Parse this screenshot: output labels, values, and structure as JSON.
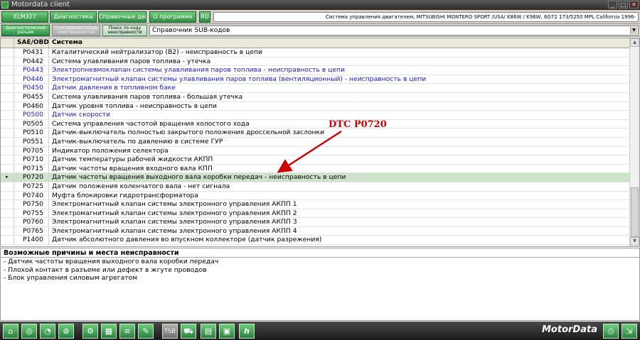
{
  "window": {
    "title": "Motordata client"
  },
  "menu": {
    "buttons": [
      "ELM327",
      "Диагностика",
      "Справочные данные",
      "О программе",
      "RU"
    ],
    "vehicle_info": "Система управления двигателем, MITSUBISHI  MONTERO SPORT /USA/  K86W / K96W,  6G72  173/5250  MPL California  1996-"
  },
  "toolbar2": {
    "btn1": "Диагностический разъём",
    "btn2": "Считывание кодов неисправностей",
    "btn3": "Поиск по коду неисправности",
    "select_value": "Справочник SUB-кодов"
  },
  "grid": {
    "headers": {
      "code": "SAE/OBD",
      "system": "Система"
    },
    "rows": [
      {
        "code": "P0431",
        "desc": "Каталитический нейтрализатор (B2) - неисправность в цепи",
        "link": false
      },
      {
        "code": "P0442",
        "desc": "Система улавливания паров топлива - утечка",
        "link": false
      },
      {
        "code": "P0443",
        "desc": "Электропневмоклапан системы улавливания паров топлива - неисправность в цепи",
        "link": true
      },
      {
        "code": "P0446",
        "desc": "Электромагнитный клапан системы улавливания паров топлива (вентиляционный) - неисправность в цепи",
        "link": true
      },
      {
        "code": "P0450",
        "desc": "Датчик давления в топливном баке",
        "link": true
      },
      {
        "code": "P0455",
        "desc": "Система улавливания паров топлива - большая утечка",
        "link": false
      },
      {
        "code": "P0460",
        "desc": "Датчик уровня топлива - неисправность в цепи",
        "link": false
      },
      {
        "code": "P0500",
        "desc": "Датчик скорости",
        "link": true
      },
      {
        "code": "P0505",
        "desc": "Система управления частотой вращения холостого хода",
        "link": false
      },
      {
        "code": "P0510",
        "desc": "Датчик-выключатель полностью закрытого положения дроссельной заслонки",
        "link": false
      },
      {
        "code": "P0551",
        "desc": "Датчик-выключатель по давлению в системе ГУР",
        "link": false
      },
      {
        "code": "P0705",
        "desc": "Индикатор положения селектора",
        "link": false
      },
      {
        "code": "P0710",
        "desc": "Датчик температуры рабочей жидкости АКПП",
        "link": false
      },
      {
        "code": "P0715",
        "desc": "Датчик частоты вращения входного вала КПП",
        "link": false
      },
      {
        "code": "P0720",
        "desc": "Датчик частоты вращения выходного вала коробки передач - неисправность в цепи",
        "link": false,
        "selected": true
      },
      {
        "code": "P0725",
        "desc": "Датчик положения коленчатого вала - нет сигнала",
        "link": false
      },
      {
        "code": "P0740",
        "desc": "Муфта блокировки гидротрансформатора",
        "link": false
      },
      {
        "code": "P0750",
        "desc": "Электромагнитный клапан системы электронного управления АКПП 1",
        "link": false
      },
      {
        "code": "P0755",
        "desc": "Электромагнитный клапан системы электронного управления АКПП 2",
        "link": false
      },
      {
        "code": "P0760",
        "desc": "Электромагнитный клапан системы электронного управления АКПП 3",
        "link": false
      },
      {
        "code": "P0765",
        "desc": "Электромагнитный клапан системы электронного управления АКПП 4",
        "link": false
      },
      {
        "code": "P1400",
        "desc": "Датчик абсолютного давления во впускном коллекторе (датчик разрежения)",
        "link": false
      }
    ]
  },
  "annotation": {
    "text": "DTC P0720",
    "color": "#cc0000"
  },
  "causes": {
    "title": "Возможные причины и места неисправности",
    "items": [
      "- Датчик частоты вращения выходного вала коробки передач",
      "- Плохой контакт в разъеме или дефект в жгуте проводов",
      "- Блок управления силовым агрегатом"
    ]
  },
  "bottombar": {
    "brand": "MotorData",
    "icons": [
      "home-icon",
      "connector-icon",
      "gauge-icon",
      "wheel-icon",
      "engine-icon",
      "chart-icon",
      "data-icon",
      "tools-icon",
      "tsb-icon",
      "truck-icon",
      "document-icon",
      "grid-icon",
      "h-icon",
      "print-icon",
      "export-icon"
    ],
    "labels": {
      "tsb": "TSB",
      "h": "h"
    }
  },
  "colors": {
    "accent_green": "#2e8b45",
    "link_blue": "#1a1ad0",
    "selected_row": "#cfe2cb"
  }
}
